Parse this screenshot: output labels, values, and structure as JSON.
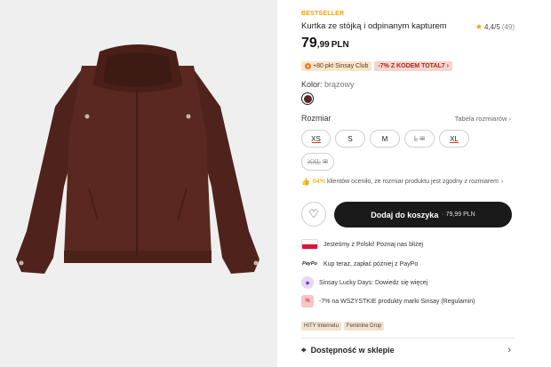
{
  "product": {
    "badge": "BESTSELLER",
    "title": "Kurtka ze stójką i odpinanym kapturem",
    "rating": {
      "value": "4,4/5",
      "count": "(49)"
    },
    "price": {
      "main": "79",
      "decimals": ",99",
      "currency": "PLN"
    },
    "promos": {
      "club": "+80 pkt Sinsay Club",
      "code": "-7% Z KODEM TOTAL7"
    },
    "color": {
      "label": "Kolor:",
      "value": "brązowy",
      "swatch_hex": "#5a2820"
    },
    "sizes": {
      "label": "Rozmiar",
      "table_link": "Tabela rozmiarów",
      "items": [
        "XS",
        "S",
        "M",
        "L",
        "XL",
        "XXL"
      ]
    },
    "fit": {
      "pct": "64%",
      "text": "klientów oceniło, że rozmiar produktu jest zgodny z rozmiarem"
    },
    "cart": {
      "label": "Dodaj do koszyka",
      "price": "· 79,99 PLN"
    },
    "benefits": [
      "Jesteśmy z Polski! Poznaj nas bliżej",
      "Kup teraz, zapłać później z PayPo",
      "Sinsay Lucky Days: Dowiedz się więcej",
      "-7% na WSZYSTKIE produkty marki Sinsay (Regulamin)"
    ],
    "paypo_icon_text": "PayPo",
    "tags": [
      "HITY Internetu",
      "Feminine Drop"
    ],
    "store": "Dostępność w sklepie"
  },
  "colors": {
    "accent": "#f0a000",
    "button": "#1a1a1a",
    "jacket": "#5a2820",
    "sale": "#d9301e"
  }
}
